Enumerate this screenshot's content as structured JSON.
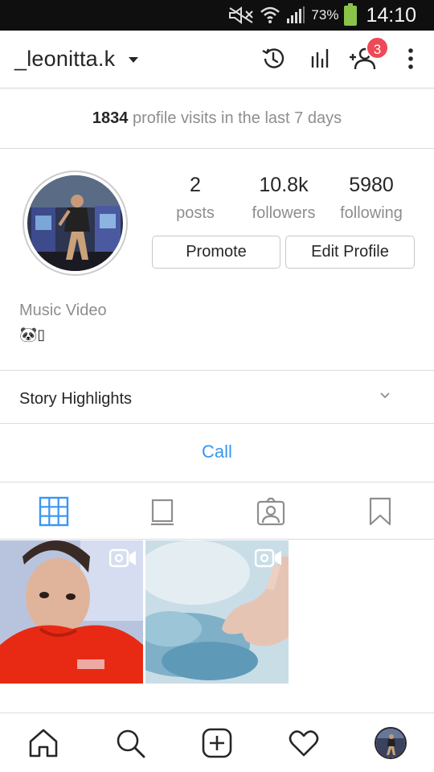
{
  "status_bar": {
    "battery_pct": "73%",
    "time": "14:10"
  },
  "header": {
    "username": "_leonitta.k",
    "notification_count": "3"
  },
  "insights_banner": {
    "count": "1834",
    "text": "profile visits in the last 7 days"
  },
  "profile": {
    "stats": [
      {
        "value": "2",
        "label": "posts"
      },
      {
        "value": "10.8k",
        "label": "followers"
      },
      {
        "value": "5980",
        "label": "following"
      }
    ],
    "promote_label": "Promote",
    "edit_label": "Edit Profile",
    "category": "Music Video",
    "bio_emoji": "🐼▯"
  },
  "highlights": {
    "title": "Story Highlights"
  },
  "contact": {
    "call_label": "Call"
  },
  "colors": {
    "accent": "#3897f0",
    "badge": "#ed4956",
    "grid_tab_active": "#3897f0"
  },
  "tabs": [
    "grid-icon",
    "feed-icon",
    "tagged-icon",
    "saved-icon"
  ],
  "bottom_nav": [
    "home-icon",
    "search-icon",
    "new-post-icon",
    "activity-icon",
    "profile-avatar"
  ]
}
